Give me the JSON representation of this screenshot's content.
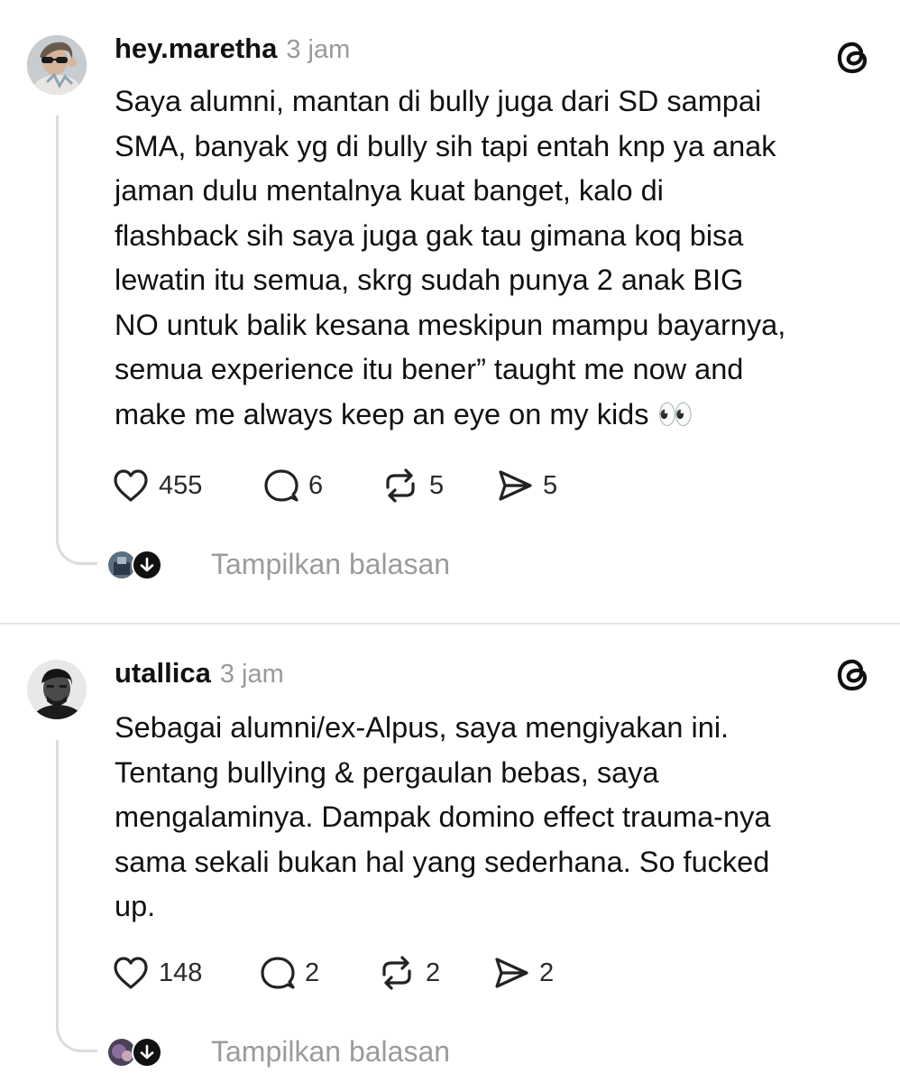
{
  "posts": [
    {
      "username": "hey.maretha",
      "time": "3 jam",
      "text": "Saya alumni, mantan di bully juga dari SD sampai\nSMA, banyak yg di bully sih tapi entah knp ya anak\njaman dulu mentalnya kuat banget, kalo di\nflashback sih saya juga gak tau gimana koq bisa\nlewatin itu semua, skrg sudah punya 2 anak BIG\nNO untuk balik kesana meskipun mampu bayarnya,\nsemua experience itu bener” taught me now and\nmake me always keep an eye on my kids 👀",
      "likes": "455",
      "comments": "6",
      "reposts": "5",
      "shares": "5",
      "replies_label": "Tampilkan balasan",
      "icons": {
        "like": "heart-icon",
        "comment": "comment-icon",
        "repost": "repost-icon",
        "share": "share-icon",
        "logo": "threads-logo-icon",
        "expand": "arrow-down-icon"
      }
    },
    {
      "username": "utallica",
      "time": "3 jam",
      "text": "Sebagai alumni/ex-Alpus, saya mengiyakan ini.\nTentang bullying & pergaulan bebas, saya\nmengalaminya. Dampak domino effect trauma-nya\nsama sekali bukan hal yang sederhana. So fucked\nup.",
      "likes": "148",
      "comments": "2",
      "reposts": "2",
      "shares": "2",
      "replies_label": "Tampilkan balasan",
      "icons": {
        "like": "heart-icon",
        "comment": "comment-icon",
        "repost": "repost-icon",
        "share": "share-icon",
        "logo": "threads-logo-icon",
        "expand": "arrow-down-icon"
      }
    }
  ],
  "colors": {
    "text": "#111111",
    "muted": "#9a9a9a",
    "thread_line": "#dcdcdc",
    "divider": "#e4e4e4"
  }
}
